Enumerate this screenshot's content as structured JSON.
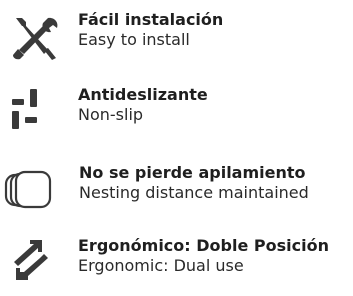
{
  "features": [
    {
      "icon": "tools-icon",
      "title": "Fácil instalación",
      "subtitle": "Easy to install"
    },
    {
      "icon": "non-slip-icon",
      "title": "Antideslizante",
      "subtitle": "Non-slip"
    },
    {
      "icon": "stacked-glides-icon",
      "title": "No se pierde apilamiento",
      "subtitle": "Nesting distance maintained"
    },
    {
      "icon": "dual-arrows-icon",
      "title": "Ergonómico: Doble Posición",
      "subtitle": "Ergonomic: Dual use"
    }
  ],
  "colors": {
    "icon": "#3a3a3a",
    "text": "#222222"
  }
}
